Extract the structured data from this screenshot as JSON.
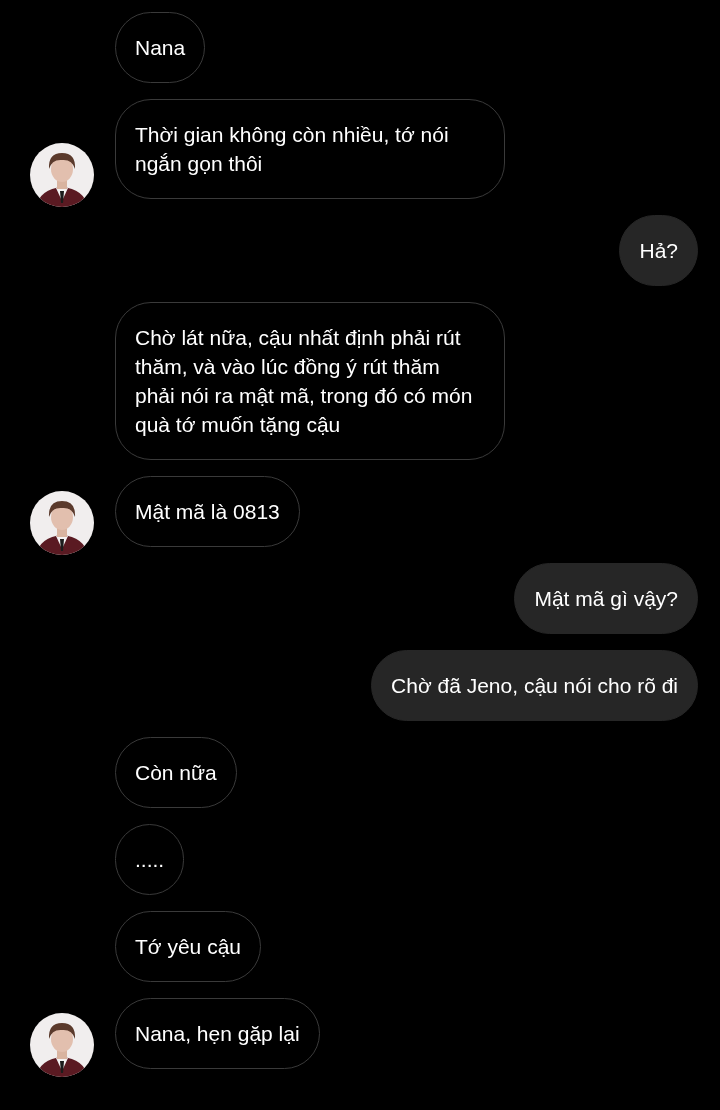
{
  "messages": [
    {
      "kind": "received",
      "avatar": false,
      "text": "Nana"
    },
    {
      "kind": "received",
      "avatar": true,
      "text": "Thời gian không còn nhiều, tớ nói ngắn gọn thôi"
    },
    {
      "kind": "sent",
      "text": "Hả?"
    },
    {
      "kind": "received",
      "avatar": false,
      "text": "Chờ lát nữa, cậu nhất định phải rút thăm, và vào lúc đồng ý rút thăm phải nói ra mật mã, trong đó có món quà tớ muốn tặng cậu"
    },
    {
      "kind": "received",
      "avatar": true,
      "text": "Mật mã là 0813"
    },
    {
      "kind": "sent",
      "text": "Mật mã gì vậy?"
    },
    {
      "kind": "sent",
      "text": "Chờ đã Jeno, cậu nói cho rõ đi"
    },
    {
      "kind": "received",
      "avatar": false,
      "text": "Còn nữa"
    },
    {
      "kind": "received",
      "avatar": false,
      "text": "....."
    },
    {
      "kind": "received",
      "avatar": false,
      "text": "Tớ yêu cậu"
    },
    {
      "kind": "received",
      "avatar": true,
      "text": "Nana, hẹn gặp lại"
    }
  ]
}
